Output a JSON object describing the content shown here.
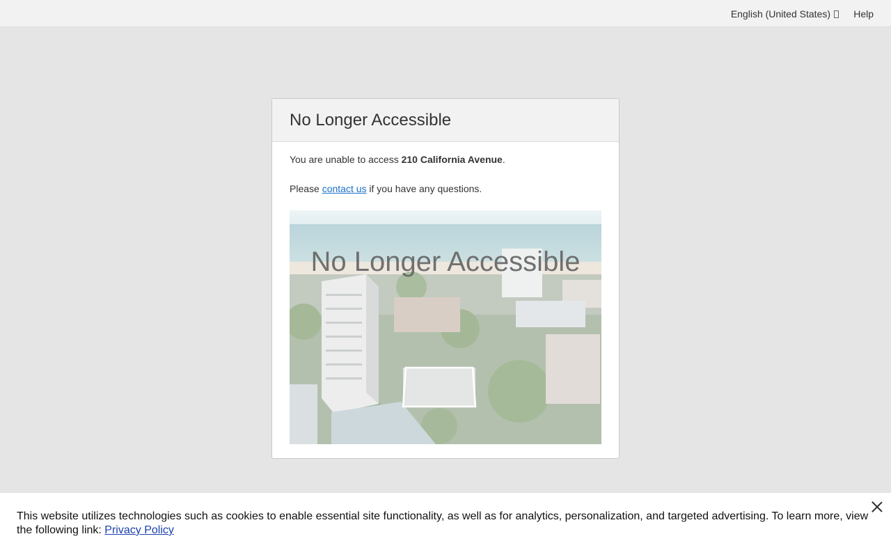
{
  "topbar": {
    "language": "English (United States)",
    "help": "Help"
  },
  "card": {
    "title": "No Longer Accessible",
    "line1_prefix": "You are unable to access ",
    "property_name": "210 California Avenue",
    "line1_suffix": ".",
    "line2_prefix": "Please ",
    "contact_link": "contact us",
    "line2_suffix": " if you have any questions.",
    "image_overlay": "No Longer Accessible"
  },
  "cookie_banner": {
    "text": "This website utilizes technologies such as cookies to enable essential site functionality, as well as for analytics, personalization, and targeted advertising. To learn more, view the following link: ",
    "link": "Privacy Policy"
  },
  "colors": {
    "background": "#e5e5e5",
    "link": "#1a6fc9"
  }
}
